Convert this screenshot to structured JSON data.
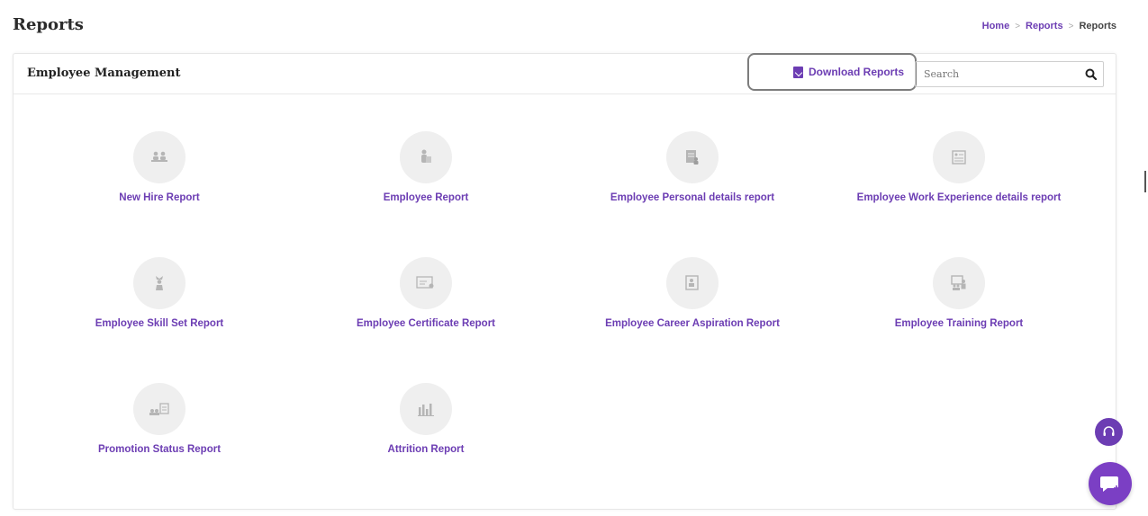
{
  "page": {
    "title": "Reports"
  },
  "breadcrumb": [
    "Home",
    "Reports",
    "Reports"
  ],
  "card": {
    "title": "Employee Management",
    "download_label": "Download Reports",
    "search_placeholder": "Search"
  },
  "reports": [
    {
      "label": "New Hire Report",
      "icon": "group-hire-icon"
    },
    {
      "label": "Employee Report",
      "icon": "employee-icon"
    },
    {
      "label": "Employee Personal details report",
      "icon": "personal-details-icon"
    },
    {
      "label": "Employee Work Experience details report",
      "icon": "work-experience-icon"
    },
    {
      "label": "Employee Skill Set Report",
      "icon": "skill-set-icon"
    },
    {
      "label": "Employee Certificate Report",
      "icon": "certificate-icon"
    },
    {
      "label": "Employee Career Aspiration Report",
      "icon": "career-aspiration-icon"
    },
    {
      "label": "Employee Training Report",
      "icon": "training-icon"
    },
    {
      "label": "Promotion Status Report",
      "icon": "promotion-icon"
    },
    {
      "label": "Attrition Report",
      "icon": "attrition-chart-icon"
    }
  ],
  "colors": {
    "accent": "#6c3db3",
    "icon_bg": "#efefef",
    "icon_fg": "#b5b5b5"
  }
}
